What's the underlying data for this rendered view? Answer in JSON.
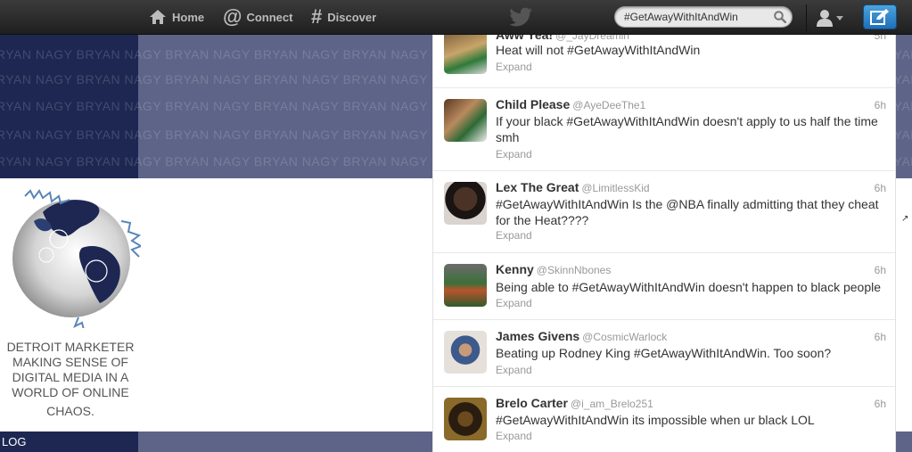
{
  "background_page": {
    "banner_text": "BRYAN NAGY",
    "tagline_lines": [
      "DETROIT MARKETER",
      "MAKING SENSE OF",
      "DIGITAL MEDIA IN A",
      "WORLD OF ONLINE",
      "CHAOS."
    ],
    "bottom_label": "LOG"
  },
  "topbar": {
    "home_label": "Home",
    "connect_label": "Connect",
    "discover_label": "Discover",
    "search_value": "#GetAwayWithItAndWin",
    "icons": [
      "home-icon",
      "at-icon",
      "hash-icon",
      "twitter-bird-icon",
      "search-icon",
      "user-icon",
      "compose-icon"
    ]
  },
  "colors": {
    "topbar": "#2b2b2b",
    "compose_button": "#2f86cf",
    "banner_dark": "#1d2751",
    "banner_gray": "#5d6487"
  },
  "tweets": [
    {
      "name": "Aww Yea!",
      "handle": "@_JayDreamin",
      "time": "5h",
      "text": "Heat will not #GetAwayWithItAndWin",
      "expand": "Expand"
    },
    {
      "name": "Child Please",
      "handle": "@AyeDeeThe1",
      "time": "6h",
      "text": "If your black #GetAwayWithItAndWin doesn't apply to us half the time smh",
      "expand": "Expand"
    },
    {
      "name": "Lex The Great",
      "handle": "@LimitlessKid",
      "time": "6h",
      "text": "#GetAwayWithItAndWin Is the @NBA finally admitting that they cheat for the Heat????",
      "expand": "Expand"
    },
    {
      "name": "Kenny",
      "handle": "@SkinnNbones",
      "time": "6h",
      "text": "Being able to #GetAwayWithItAndWin doesn't happen to black people",
      "expand": "Expand"
    },
    {
      "name": "James Givens",
      "handle": "@CosmicWarlock",
      "time": "6h",
      "text": "Beating up Rodney King #GetAwayWithItAndWin. Too soon?",
      "expand": "Expand"
    },
    {
      "name": "Brelo Carter",
      "handle": "@i_am_Brelo251",
      "time": "6h",
      "text": "#GetAwayWithItAndWin its impossible when ur black LOL",
      "expand": "Expand"
    }
  ]
}
